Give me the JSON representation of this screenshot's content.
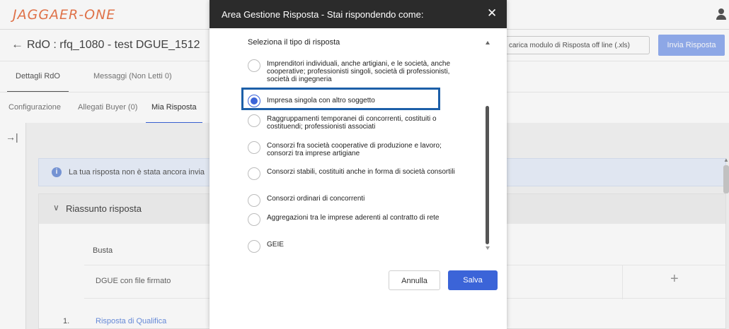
{
  "app": {
    "logo_text": "JAGGAER-ONE",
    "page_title": "RdO : rfq_1080 - test DGUE_1512",
    "download_button": "carica modulo di Risposta off line (.xls)",
    "send_button": "Invia Risposta"
  },
  "tabs_primary": [
    {
      "label": "Dettagli RdO",
      "active": true
    },
    {
      "label": "Messaggi (Non Letti 0)",
      "active": false
    }
  ],
  "tabs_secondary": [
    {
      "label": "Configurazione",
      "active": false
    },
    {
      "label": "Allegati Buyer (0)",
      "active": false
    },
    {
      "label": "Mia Risposta",
      "active": true
    }
  ],
  "content": {
    "info_text": "La tua risposta non è stata ancora invia",
    "summary_title": "Riassunto risposta",
    "column_header": "Busta",
    "row_dgue": "DGUE con file firmato",
    "row_number": "1.",
    "row_link": "Risposta di Qualifica"
  },
  "modal": {
    "title": "Area Gestione Risposta - Stai rispondendo come:",
    "section_label": "Seleziona il tipo di risposta",
    "options": [
      {
        "label": "Imprenditori individuali, anche artigiani, e le società, anche cooperative; professionisti singoli, società di professionisti, società di ingegneria",
        "checked": false
      },
      {
        "label": "Impresa singola con altro soggetto",
        "checked": true
      },
      {
        "label": "Raggruppamenti temporanei di concorrenti, costituiti o costituendi; professionisti associati",
        "checked": false
      },
      {
        "label": "Consorzi fra società cooperative di produzione e lavoro; consorzi tra imprese artigiane",
        "checked": false
      },
      {
        "label": "Consorzi stabili, costituiti anche in forma di società consortili",
        "checked": false
      },
      {
        "label": "Consorzi ordinari di concorrenti",
        "checked": false
      },
      {
        "label": "Aggregazioni tra le imprese aderenti al contratto di rete",
        "checked": false
      },
      {
        "label": "GEIE",
        "checked": false
      }
    ],
    "cancel_button": "Annulla",
    "save_button": "Salva"
  },
  "colors": {
    "accent": "#3b64d8",
    "highlight": "#1c5fa8",
    "modal_header": "#2b2b2b",
    "logo": "#e9774d"
  }
}
